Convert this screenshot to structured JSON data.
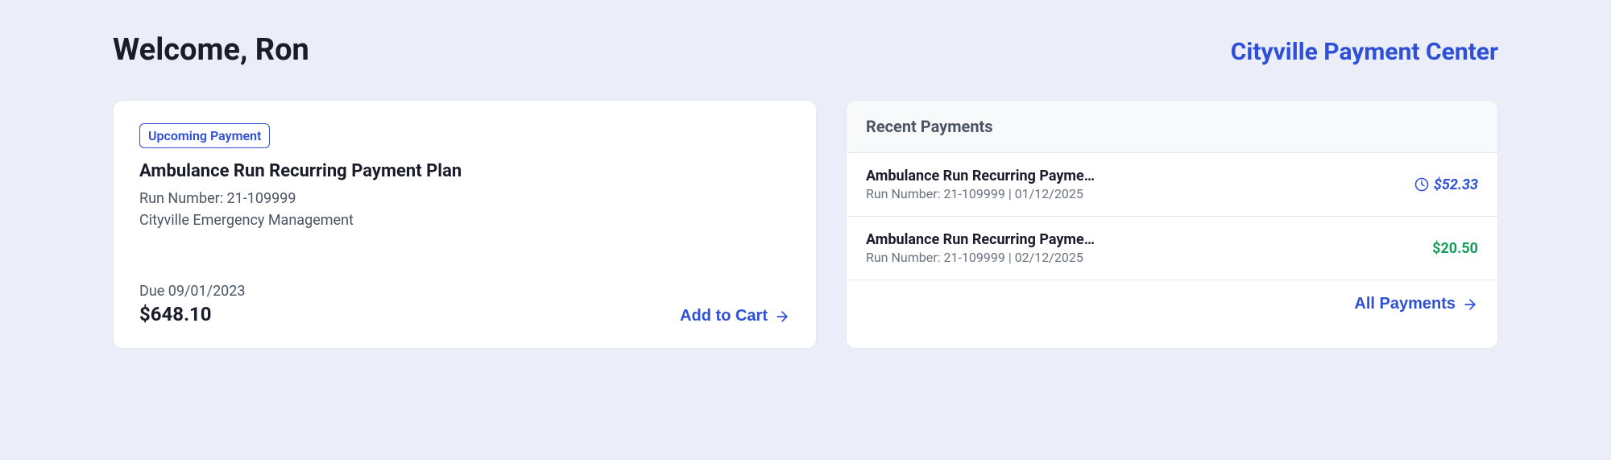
{
  "header": {
    "welcome": "Welcome, Ron",
    "center": "Cityville Payment Center"
  },
  "upcoming": {
    "badge": "Upcoming Payment",
    "title": "Ambulance Run Recurring Payment Plan",
    "run_number": "Run Number: 21-109999",
    "org": "Cityville Emergency Management",
    "due_label": "Due 09/01/2023",
    "amount": "$648.10",
    "cta": "Add to Cart"
  },
  "recent": {
    "title": "Recent Payments",
    "payments": [
      {
        "name": "Ambulance Run Recurring Payme…",
        "meta": "Run Number: 21-109999 | 01/12/2025",
        "amount": "$52.33",
        "status": "pending"
      },
      {
        "name": "Ambulance Run Recurring Payme…",
        "meta": "Run Number: 21-109999 | 02/12/2025",
        "amount": "$20.50",
        "status": "paid"
      }
    ],
    "all_label": "All Payments"
  }
}
